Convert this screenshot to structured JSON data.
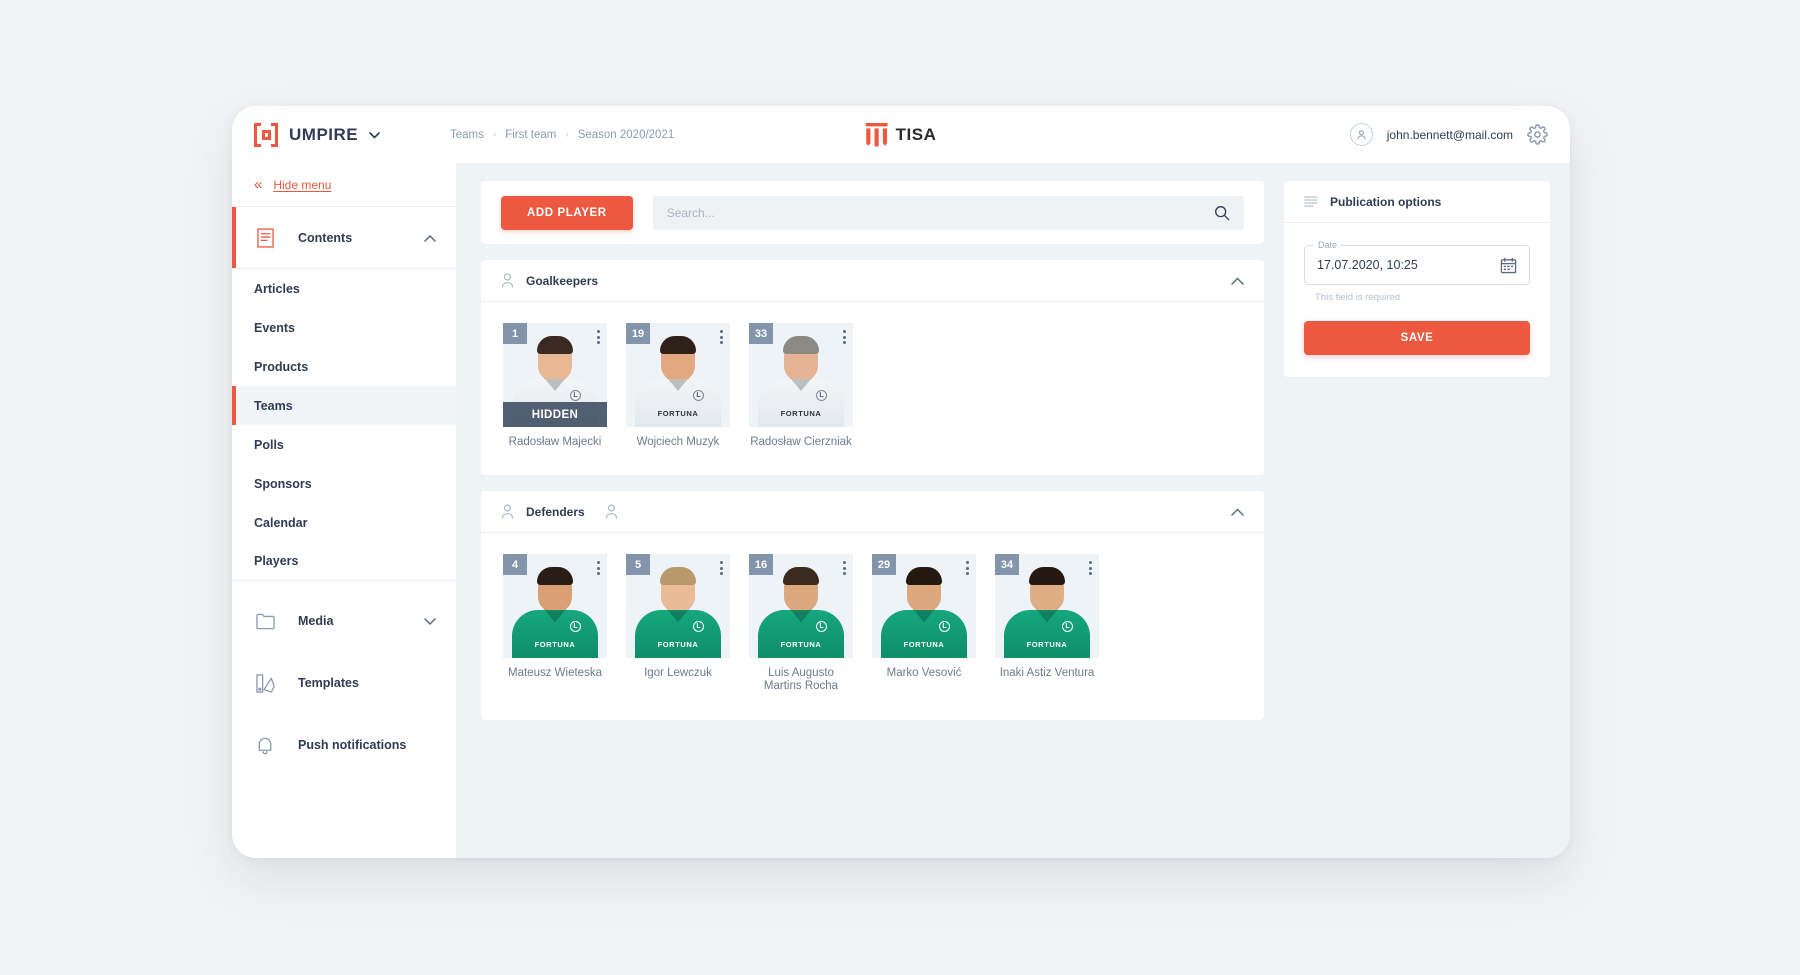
{
  "header": {
    "brand_name": "UMPIRE",
    "brand_caret": "⌄",
    "breadcrumb": [
      "Teams",
      "First team",
      "Season 2020/2021"
    ],
    "breadcrumb_sep": "›",
    "center_logo_text": "TISA",
    "user_email": "john.bennett@mail.com"
  },
  "sidebar": {
    "hide_menu": {
      "label": "Hide menu",
      "chevrons": "«"
    },
    "groups": [
      {
        "label": "Contents",
        "icon": "document-icon",
        "expanded": true,
        "chevron": "⌃"
      },
      {
        "label": "Media",
        "icon": "folder-icon",
        "expanded": false,
        "chevron": "⌄"
      },
      {
        "label": "Templates",
        "icon": "templates-icon"
      },
      {
        "label": "Push notifications",
        "icon": "bell-icon"
      }
    ],
    "contents_items": [
      {
        "label": "Articles",
        "active": false
      },
      {
        "label": "Events",
        "active": false
      },
      {
        "label": "Products",
        "active": false
      },
      {
        "label": "Teams",
        "active": true
      },
      {
        "label": "Polls",
        "active": false
      },
      {
        "label": "Sponsors",
        "active": false
      },
      {
        "label": "Calendar",
        "active": false
      },
      {
        "label": "Players",
        "active": false
      }
    ]
  },
  "toolbar": {
    "add_player_label": "ADD PLAYER",
    "search_placeholder": "Search...",
    "search_value": ""
  },
  "sections": [
    {
      "title": "Goalkeepers",
      "collapse_chevron": "⌃",
      "has_second_person_icon": false,
      "kit": "white",
      "players": [
        {
          "number": "1",
          "name": "Radosław Majecki",
          "hidden_label": "HIDDEN",
          "hidden": true,
          "skin": "#e8b894",
          "hair": "#3b2a22",
          "sponsor": ""
        },
        {
          "number": "19",
          "name": "Wojciech Muzyk",
          "hidden_label": "",
          "hidden": false,
          "skin": "#e2a87f",
          "hair": "#2e2119",
          "sponsor": "FORTUNA"
        },
        {
          "number": "33",
          "name": "Radosław Cierzniak",
          "hidden_label": "",
          "hidden": false,
          "skin": "#e6b493",
          "hair": "#8d8a86",
          "sponsor": "FORTUNA"
        }
      ]
    },
    {
      "title": "Defenders",
      "collapse_chevron": "⌃",
      "has_second_person_icon": true,
      "kit": "green",
      "players": [
        {
          "number": "4",
          "name": "Mateusz Wieteska",
          "hidden_label": "",
          "hidden": false,
          "skin": "#d8a073",
          "hair": "#2a1d16",
          "sponsor": "FORTUNA"
        },
        {
          "number": "5",
          "name": "Igor Lewczuk",
          "hidden_label": "",
          "hidden": false,
          "skin": "#e9bb96",
          "hair": "#b99a6c",
          "sponsor": "FORTUNA"
        },
        {
          "number": "16",
          "name": "Luis Augusto Martins Rocha",
          "hidden_label": "",
          "hidden": false,
          "skin": "#dda87d",
          "hair": "#3a2a20",
          "sponsor": "FORTUNA"
        },
        {
          "number": "29",
          "name": "Marko Vesović",
          "hidden_label": "",
          "hidden": false,
          "skin": "#dda87d",
          "hair": "#24190f",
          "sponsor": "FORTUNA"
        },
        {
          "number": "34",
          "name": "Inaki Astiz Ventura",
          "hidden_label": "",
          "hidden": false,
          "skin": "#dfae85",
          "hair": "#241a12",
          "sponsor": "FORTUNA"
        }
      ]
    }
  ],
  "publication": {
    "title": "Publication options",
    "date_label": "Date",
    "date_value": "17.07.2020, 10:25",
    "helper_text": "This field is required",
    "save_label": "SAVE"
  },
  "colors": {
    "accent": "#ec5840",
    "ink": "#2f3c54",
    "muted": "#8c9bb0",
    "canvas": "#eef3f6",
    "kit_green": "#13a077"
  }
}
